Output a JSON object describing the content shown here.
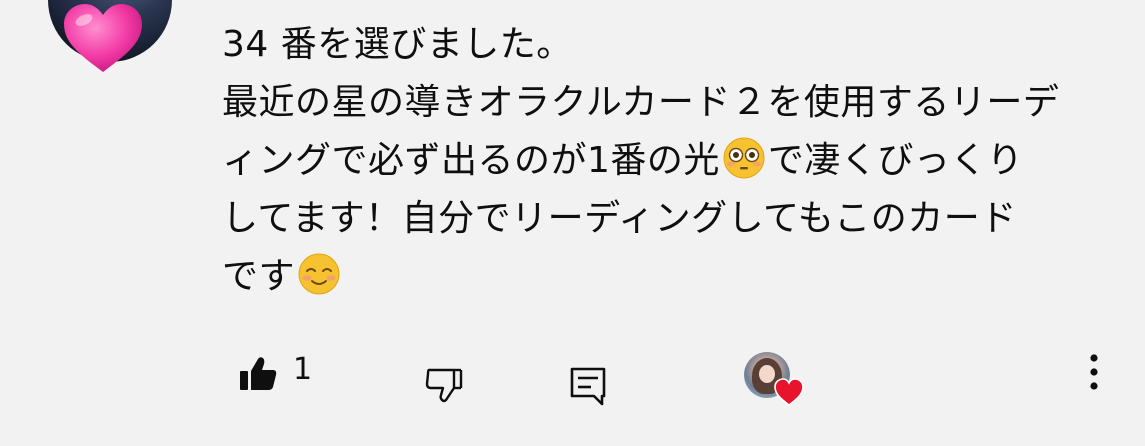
{
  "avatar": {
    "icon": "pink-heart-icon"
  },
  "comment": {
    "lines": [
      "34 番を選びました。",
      "最近の星の導きオラクルカード２を使用するリーデ",
      "ィングで必ず出るのが1番の光",
      "で凄くびっくり",
      "してます！自分でリーディングしてもこのカード",
      "です"
    ],
    "emojis": [
      "flushed-face-icon",
      "smiling-face-icon"
    ]
  },
  "actions": {
    "like_count": "1",
    "icons": [
      "thumbs-up-icon",
      "thumbs-down-icon",
      "reply-icon",
      "creator-heart-icon",
      "more-vertical-icon"
    ]
  },
  "colors": {
    "background": "#f2f2f2",
    "text": "#0f0f0f",
    "heart": "#e8132c"
  }
}
